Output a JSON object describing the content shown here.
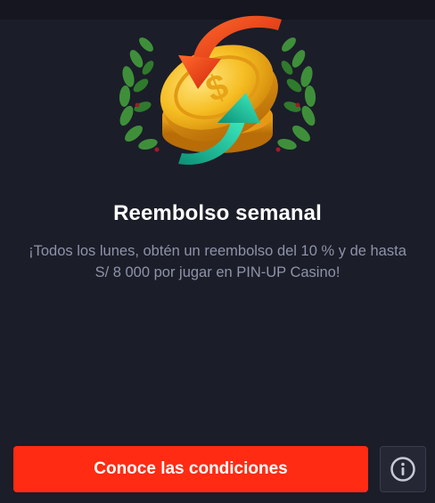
{
  "promo": {
    "title": "Reembolso semanal",
    "description": "¡Todos los lunes, obtén un reembolso del 10 % y de hasta S/ 8 000 por jugar en PIN-UP Casino!",
    "cta_label": "Conoce las condiciones",
    "info_icon": "info-circle-icon",
    "illustration_icon": "cashback-coin-icon"
  },
  "colors": {
    "background": "#1b1d29",
    "cta": "#ff2b12",
    "text_primary": "#ffffff",
    "text_secondary": "#8e93a8",
    "coin": "#f2b51c",
    "arrow_red": "#ea3a18",
    "arrow_green": "#1ec9a0",
    "laurel": "#3f8f3a"
  }
}
